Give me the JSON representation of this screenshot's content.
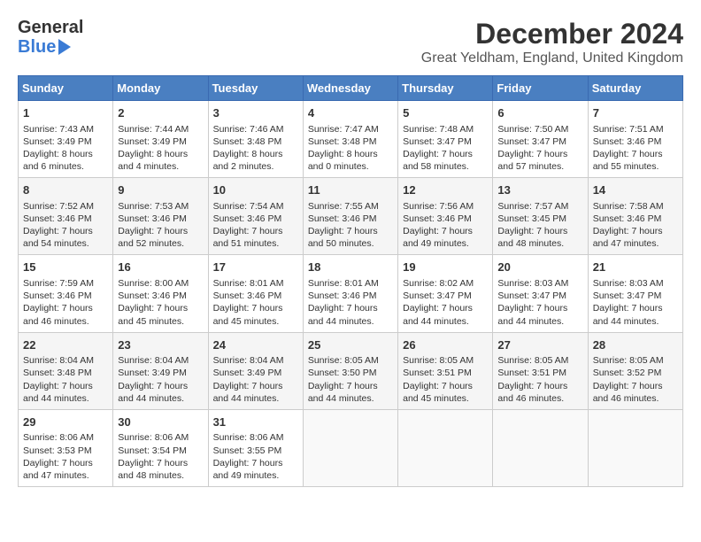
{
  "header": {
    "logo_line1a": "General",
    "logo_line1b": "",
    "logo_line2": "Blue",
    "title": "December 2024",
    "subtitle": "Great Yeldham, England, United Kingdom"
  },
  "calendar": {
    "days_header": [
      "Sunday",
      "Monday",
      "Tuesday",
      "Wednesday",
      "Thursday",
      "Friday",
      "Saturday"
    ],
    "weeks": [
      [
        {
          "day": "1",
          "sunrise": "Sunrise: 7:43 AM",
          "sunset": "Sunset: 3:49 PM",
          "daylight": "Daylight: 8 hours and 6 minutes."
        },
        {
          "day": "2",
          "sunrise": "Sunrise: 7:44 AM",
          "sunset": "Sunset: 3:49 PM",
          "daylight": "Daylight: 8 hours and 4 minutes."
        },
        {
          "day": "3",
          "sunrise": "Sunrise: 7:46 AM",
          "sunset": "Sunset: 3:48 PM",
          "daylight": "Daylight: 8 hours and 2 minutes."
        },
        {
          "day": "4",
          "sunrise": "Sunrise: 7:47 AM",
          "sunset": "Sunset: 3:48 PM",
          "daylight": "Daylight: 8 hours and 0 minutes."
        },
        {
          "day": "5",
          "sunrise": "Sunrise: 7:48 AM",
          "sunset": "Sunset: 3:47 PM",
          "daylight": "Daylight: 7 hours and 58 minutes."
        },
        {
          "day": "6",
          "sunrise": "Sunrise: 7:50 AM",
          "sunset": "Sunset: 3:47 PM",
          "daylight": "Daylight: 7 hours and 57 minutes."
        },
        {
          "day": "7",
          "sunrise": "Sunrise: 7:51 AM",
          "sunset": "Sunset: 3:46 PM",
          "daylight": "Daylight: 7 hours and 55 minutes."
        }
      ],
      [
        {
          "day": "8",
          "sunrise": "Sunrise: 7:52 AM",
          "sunset": "Sunset: 3:46 PM",
          "daylight": "Daylight: 7 hours and 54 minutes."
        },
        {
          "day": "9",
          "sunrise": "Sunrise: 7:53 AM",
          "sunset": "Sunset: 3:46 PM",
          "daylight": "Daylight: 7 hours and 52 minutes."
        },
        {
          "day": "10",
          "sunrise": "Sunrise: 7:54 AM",
          "sunset": "Sunset: 3:46 PM",
          "daylight": "Daylight: 7 hours and 51 minutes."
        },
        {
          "day": "11",
          "sunrise": "Sunrise: 7:55 AM",
          "sunset": "Sunset: 3:46 PM",
          "daylight": "Daylight: 7 hours and 50 minutes."
        },
        {
          "day": "12",
          "sunrise": "Sunrise: 7:56 AM",
          "sunset": "Sunset: 3:46 PM",
          "daylight": "Daylight: 7 hours and 49 minutes."
        },
        {
          "day": "13",
          "sunrise": "Sunrise: 7:57 AM",
          "sunset": "Sunset: 3:45 PM",
          "daylight": "Daylight: 7 hours and 48 minutes."
        },
        {
          "day": "14",
          "sunrise": "Sunrise: 7:58 AM",
          "sunset": "Sunset: 3:46 PM",
          "daylight": "Daylight: 7 hours and 47 minutes."
        }
      ],
      [
        {
          "day": "15",
          "sunrise": "Sunrise: 7:59 AM",
          "sunset": "Sunset: 3:46 PM",
          "daylight": "Daylight: 7 hours and 46 minutes."
        },
        {
          "day": "16",
          "sunrise": "Sunrise: 8:00 AM",
          "sunset": "Sunset: 3:46 PM",
          "daylight": "Daylight: 7 hours and 45 minutes."
        },
        {
          "day": "17",
          "sunrise": "Sunrise: 8:01 AM",
          "sunset": "Sunset: 3:46 PM",
          "daylight": "Daylight: 7 hours and 45 minutes."
        },
        {
          "day": "18",
          "sunrise": "Sunrise: 8:01 AM",
          "sunset": "Sunset: 3:46 PM",
          "daylight": "Daylight: 7 hours and 44 minutes."
        },
        {
          "day": "19",
          "sunrise": "Sunrise: 8:02 AM",
          "sunset": "Sunset: 3:47 PM",
          "daylight": "Daylight: 7 hours and 44 minutes."
        },
        {
          "day": "20",
          "sunrise": "Sunrise: 8:03 AM",
          "sunset": "Sunset: 3:47 PM",
          "daylight": "Daylight: 7 hours and 44 minutes."
        },
        {
          "day": "21",
          "sunrise": "Sunrise: 8:03 AM",
          "sunset": "Sunset: 3:47 PM",
          "daylight": "Daylight: 7 hours and 44 minutes."
        }
      ],
      [
        {
          "day": "22",
          "sunrise": "Sunrise: 8:04 AM",
          "sunset": "Sunset: 3:48 PM",
          "daylight": "Daylight: 7 hours and 44 minutes."
        },
        {
          "day": "23",
          "sunrise": "Sunrise: 8:04 AM",
          "sunset": "Sunset: 3:49 PM",
          "daylight": "Daylight: 7 hours and 44 minutes."
        },
        {
          "day": "24",
          "sunrise": "Sunrise: 8:04 AM",
          "sunset": "Sunset: 3:49 PM",
          "daylight": "Daylight: 7 hours and 44 minutes."
        },
        {
          "day": "25",
          "sunrise": "Sunrise: 8:05 AM",
          "sunset": "Sunset: 3:50 PM",
          "daylight": "Daylight: 7 hours and 44 minutes."
        },
        {
          "day": "26",
          "sunrise": "Sunrise: 8:05 AM",
          "sunset": "Sunset: 3:51 PM",
          "daylight": "Daylight: 7 hours and 45 minutes."
        },
        {
          "day": "27",
          "sunrise": "Sunrise: 8:05 AM",
          "sunset": "Sunset: 3:51 PM",
          "daylight": "Daylight: 7 hours and 46 minutes."
        },
        {
          "day": "28",
          "sunrise": "Sunrise: 8:05 AM",
          "sunset": "Sunset: 3:52 PM",
          "daylight": "Daylight: 7 hours and 46 minutes."
        }
      ],
      [
        {
          "day": "29",
          "sunrise": "Sunrise: 8:06 AM",
          "sunset": "Sunset: 3:53 PM",
          "daylight": "Daylight: 7 hours and 47 minutes."
        },
        {
          "day": "30",
          "sunrise": "Sunrise: 8:06 AM",
          "sunset": "Sunset: 3:54 PM",
          "daylight": "Daylight: 7 hours and 48 minutes."
        },
        {
          "day": "31",
          "sunrise": "Sunrise: 8:06 AM",
          "sunset": "Sunset: 3:55 PM",
          "daylight": "Daylight: 7 hours and 49 minutes."
        },
        null,
        null,
        null,
        null
      ]
    ]
  }
}
